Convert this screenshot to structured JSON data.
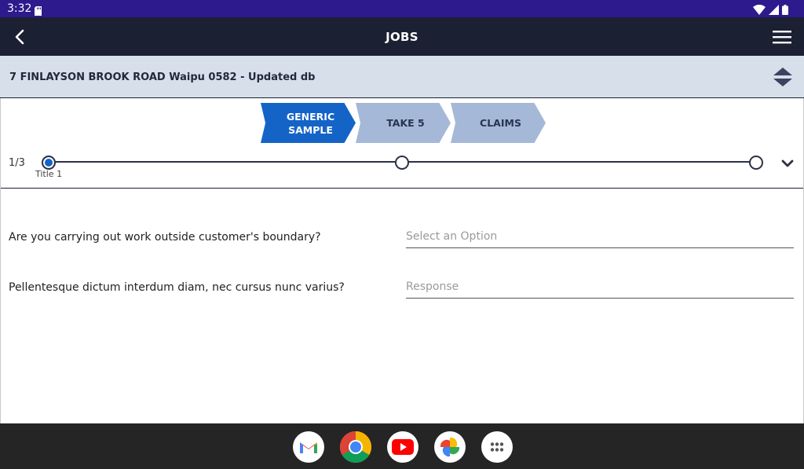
{
  "status_bar": {
    "time": "3:32",
    "icons": [
      "sd-card-icon",
      "wifi-icon",
      "signal-icon",
      "battery-icon"
    ]
  },
  "app_bar": {
    "title": "JOBS",
    "back_icon": "chevron-left-icon",
    "menu_icon": "hamburger-menu-icon"
  },
  "address_bar": {
    "text": "7 FINLAYSON BROOK ROAD Waipu 0582 - Updated db",
    "sort_icon": "sort-up-down-icon"
  },
  "steps": [
    {
      "label": "GENERIC\nSAMPLE",
      "active": true
    },
    {
      "label": "TAKE 5",
      "active": false
    },
    {
      "label": "CLAIMS",
      "active": false
    }
  ],
  "progress": {
    "count": "1/3",
    "current_label": "Title 1",
    "expand_icon": "chevron-down-icon"
  },
  "form": {
    "questions": [
      {
        "text": "Are you carrying out work outside customer's boundary?",
        "placeholder": "Select an Option"
      },
      {
        "text": "Pellentesque dictum interdum diam, nec cursus nunc varius?",
        "placeholder": "Response"
      }
    ]
  },
  "dock": {
    "apps": [
      "gmail-icon",
      "chrome-icon",
      "youtube-icon",
      "photos-icon",
      "app-drawer-icon"
    ]
  },
  "colors": {
    "status_bar": "#2d1a8c",
    "app_bar": "#1b2032",
    "address_bar": "#d7dfeb",
    "step_active": "#1464c8",
    "step_inactive": "#a5b8d8"
  }
}
